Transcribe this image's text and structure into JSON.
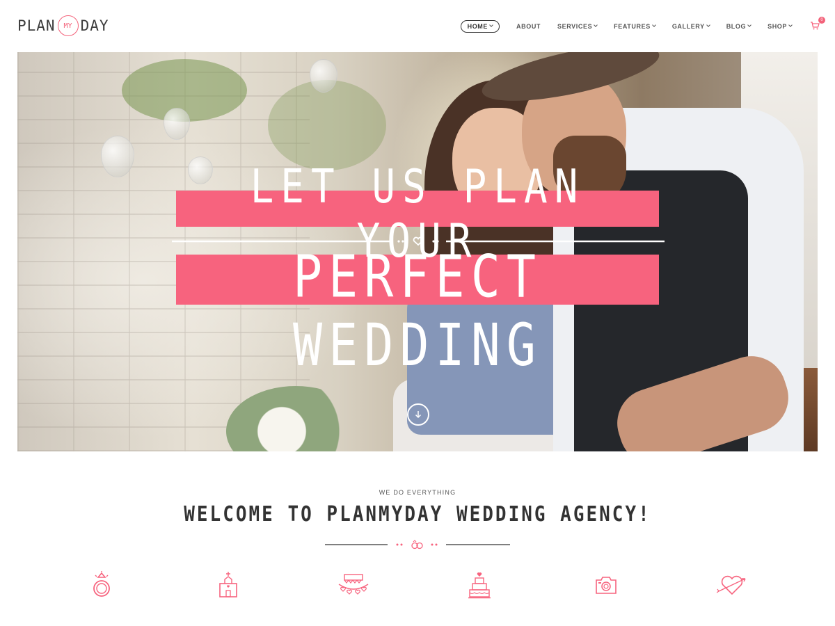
{
  "logo": {
    "left": "PLAN",
    "middle": "MY",
    "right": "DAY"
  },
  "nav": {
    "items": [
      {
        "label": "HOME",
        "dropdown": true,
        "active": true
      },
      {
        "label": "ABOUT",
        "dropdown": false
      },
      {
        "label": "SERVICES",
        "dropdown": true
      },
      {
        "label": "FEATURES",
        "dropdown": true
      },
      {
        "label": "GALLERY",
        "dropdown": true
      },
      {
        "label": "BLOG",
        "dropdown": true
      },
      {
        "label": "SHOP",
        "dropdown": true
      }
    ],
    "cart_count": "0",
    "cart_icon": "cart-icon"
  },
  "hero": {
    "line1": "LET US PLAN YOUR",
    "line2": "PERFECT WEDDING",
    "divider_icon": "heart-icon",
    "scroll_icon": "arrow-down-icon"
  },
  "welcome": {
    "eyebrow": "WE DO EVERYTHING",
    "title": "WELCOME TO PLANMYDAY WEDDING AGENCY!",
    "divider_icon": "rings-icon"
  },
  "services": {
    "icons": [
      "ring-icon",
      "chapel-icon",
      "bunting-icon",
      "cake-icon",
      "camera-icon",
      "heart-arrow-icon"
    ]
  },
  "colors": {
    "accent": "#f7637e",
    "text": "#333333"
  }
}
